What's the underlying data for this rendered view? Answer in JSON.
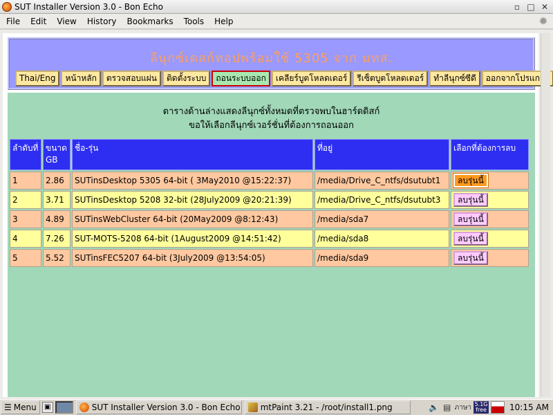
{
  "window": {
    "title": "SUT Installer Version 3.0 - Bon Echo"
  },
  "menubar": {
    "items": [
      {
        "label": "File"
      },
      {
        "label": "Edit"
      },
      {
        "label": "View"
      },
      {
        "label": "History"
      },
      {
        "label": "Bookmarks"
      },
      {
        "label": "Tools"
      },
      {
        "label": "Help"
      }
    ]
  },
  "header": {
    "title": "ลีนุกซ์เดสก์ทอปพร้อมใช้ 5305 จาก มทส."
  },
  "nav": {
    "items": [
      {
        "label": "Thai/Eng"
      },
      {
        "label": "หน้าหลัก"
      },
      {
        "label": "ตรวจสอบแผ่น"
      },
      {
        "label": "ติดตั้งระบบ"
      },
      {
        "label": "ถอนระบบออก"
      },
      {
        "label": "เคลียร์บูตโหลดเดอร์"
      },
      {
        "label": "รีเซ็ตบูตโหลดเดอร์"
      },
      {
        "label": "ทำลีนุกซ์ซีดี"
      },
      {
        "label": "ออกจากโปรแกรม"
      }
    ],
    "active_index": 4
  },
  "main": {
    "instruction_line1": "ตารางด้านล่างแสดงลีนุกซ์ทั้งหมดที่ตรวจพบในฮาร์ดดิสก์",
    "instruction_line2": "ขอให้เลือกลีนุกซ์เวอร์ชั่นที่ต้องการถอนออก"
  },
  "table": {
    "headers": {
      "index": "ลำดับที่",
      "size_line1": "ขนาด",
      "size_line2": "GB",
      "name": "ชื่อ-รุ่น",
      "location": "ที่อยู่",
      "action": "เลือกที่ต้องการลบ"
    },
    "rows": [
      {
        "index": "1",
        "size": "2.86",
        "name": "SUTinsDesktop 5305 64-bit  ( 3May2010  @15:22:37)",
        "location": "/media/Drive_C_ntfs/dsutubt1",
        "button": "ลบรุ่นนี้"
      },
      {
        "index": "2",
        "size": "3.71",
        "name": "SUTinsDesktop  5208  32-bit  (28July2009  @20:21:39)",
        "location": "/media/Drive_C_ntfs/dsutubt3",
        "button": "ลบรุ่นนี้"
      },
      {
        "index": "3",
        "size": "4.89",
        "name": "SUTinsWebCluster  64-bit  (20May2009  @8:12:43)",
        "location": "/media/sda7",
        "button": "ลบรุ่นนี้"
      },
      {
        "index": "4",
        "size": "7.26",
        "name": "SUT-MOTS-5208  64-bit  (1August2009  @14:51:42)",
        "location": "/media/sda8",
        "button": "ลบรุ่นนี้"
      },
      {
        "index": "5",
        "size": "5.52",
        "name": "SUTinsFEC5207  64-bit  (3July2009  @13:54:05)",
        "location": "/media/sda9",
        "button": "ลบรุ่นนี้"
      }
    ]
  },
  "taskbar": {
    "menu_label": "Menu",
    "tasks": [
      {
        "label": "SUT Installer Version 3.0 - Bon Echo",
        "icon": "firefox-icon"
      },
      {
        "label": "mtPaint 3.21 - /root/install1.png",
        "icon": "paint-icon"
      }
    ],
    "keyboard": "ภาษา",
    "mem_line1": "5.1G",
    "mem_line2": "free",
    "clock": "10:15 AM"
  }
}
